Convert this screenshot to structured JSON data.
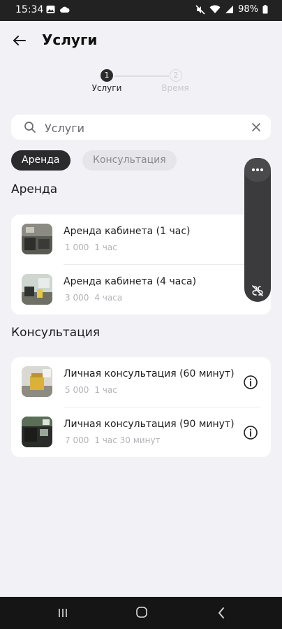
{
  "status_bar": {
    "time": "15:34",
    "battery": "98%",
    "icons": [
      "photo-icon",
      "cloud-icon",
      "mute-icon",
      "wifi-icon",
      "signal-icon",
      "battery-icon"
    ]
  },
  "header": {
    "title": "Услуги",
    "back_icon": "back-arrow-icon"
  },
  "stepper": {
    "steps": [
      {
        "number": "1",
        "label": "Услуги",
        "active": true
      },
      {
        "number": "2",
        "label": "Время",
        "active": false
      }
    ]
  },
  "search": {
    "placeholder": "Услуги",
    "value": ""
  },
  "filters": {
    "chips": [
      {
        "label": "Аренда",
        "selected": true
      },
      {
        "label": "Консультация",
        "selected": false
      }
    ]
  },
  "sections": [
    {
      "title": "Аренда",
      "items": [
        {
          "title": "Аренда кабинета (1 час)",
          "price": "1 000",
          "duration": "1 час"
        },
        {
          "title": "Аренда кабинета (4 часа)",
          "price": "3 000",
          "duration": "4 часа"
        }
      ]
    },
    {
      "title": "Консультация",
      "items": [
        {
          "title": "Личная консультация (60 минут)",
          "price": "5 000",
          "duration": "1 час"
        },
        {
          "title": "Личная консультация (90 минут)",
          "price": "7 000",
          "duration": "1 час 30 минут"
        }
      ]
    }
  ],
  "colors": {
    "background": "#f2f1f6",
    "accent": "#2b2b2d",
    "card": "#ffffff",
    "muted_text": "#b3b3b8"
  }
}
